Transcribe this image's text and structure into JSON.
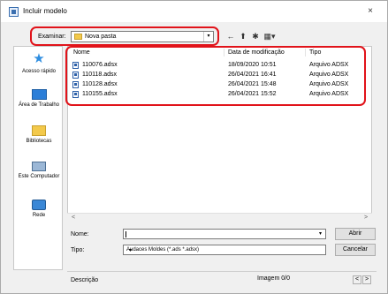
{
  "window": {
    "title": "Incluir modelo",
    "close_glyph": "×"
  },
  "toolbar": {
    "examinar_label": "Examinar:",
    "folder": "Nova pasta",
    "drop_glyph": "▾",
    "back_glyph": "←",
    "up_glyph": "⬆",
    "newfolder_glyph": "✱",
    "view_glyph": "▦▾"
  },
  "places": [
    {
      "label": "Acesso rápido",
      "icon": "star-icon"
    },
    {
      "label": "Área de Trabalho",
      "icon": "desktop-icon"
    },
    {
      "label": "Bibliotecas",
      "icon": "library-icon"
    },
    {
      "label": "Este Computador",
      "icon": "computer-icon"
    },
    {
      "label": "Rede",
      "icon": "network-icon"
    }
  ],
  "columns": {
    "name": "Nome",
    "date": "Data de modificação",
    "type": "Tipo"
  },
  "files": [
    {
      "name": "110076.adsx",
      "date": "18/09/2020 10:51",
      "type": "Arquivo ADSX"
    },
    {
      "name": "110118.adsx",
      "date": "26/04/2021 16:41",
      "type": "Arquivo ADSX"
    },
    {
      "name": "110128.adsx",
      "date": "26/04/2021 15:48",
      "type": "Arquivo ADSX"
    },
    {
      "name": "110155.adsx",
      "date": "26/04/2021 15:52",
      "type": "Arquivo ADSX"
    }
  ],
  "scroll": {
    "left": "<",
    "right": ">"
  },
  "form": {
    "name_label": "Nome:",
    "name_value": "",
    "type_label": "Tipo:",
    "type_value": "Audaces Moldes (*.ads *.adsx)",
    "open_button": "Abrir",
    "cancel_button": "Cancelar"
  },
  "preview": {
    "description_label": "Descrição",
    "image_label": "Imagem 0/0",
    "prev": "<",
    "next": ">"
  },
  "colors": {
    "highlight": "#e1131a",
    "accent": "#2b7ed8"
  }
}
